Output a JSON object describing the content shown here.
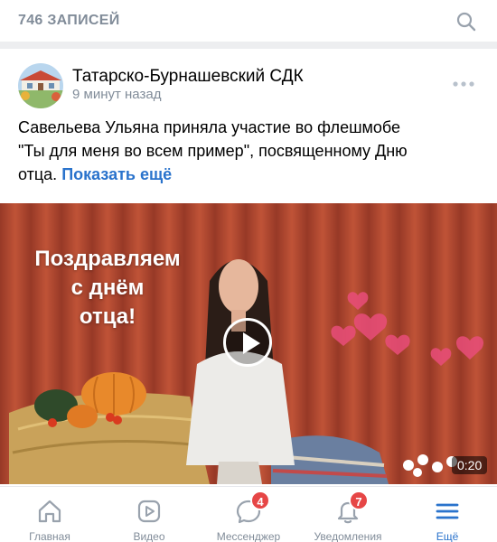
{
  "header": {
    "records_count": "746 ЗАПИСЕЙ",
    "search_icon": "search-icon"
  },
  "post": {
    "author": "Татарско-Бурнашевский СДК",
    "time": "9 минут назад",
    "text_line1": "Савельева Ульяна приняла участие во флешмобе",
    "text_line2": "\"Ты для меня во всем пример\", посвященному Дню",
    "text_line3": "отца.",
    "show_more": "Показать ещё",
    "video": {
      "overlay_line1": "Поздравляем",
      "overlay_line2": "с днём",
      "overlay_line3": "отца!",
      "duration": "0:20"
    }
  },
  "tabbar": {
    "tabs": [
      {
        "label": "Главная",
        "icon": "home-icon"
      },
      {
        "label": "Видео",
        "icon": "video-icon"
      },
      {
        "label": "Мессенджер",
        "icon": "messenger-icon",
        "badge": "4"
      },
      {
        "label": "Уведомления",
        "icon": "bell-icon",
        "badge": "7"
      },
      {
        "label": "Ещё",
        "icon": "menu-icon"
      }
    ]
  },
  "colors": {
    "accent": "#2a73cc",
    "muted": "#818c99",
    "badge": "#e64646"
  }
}
